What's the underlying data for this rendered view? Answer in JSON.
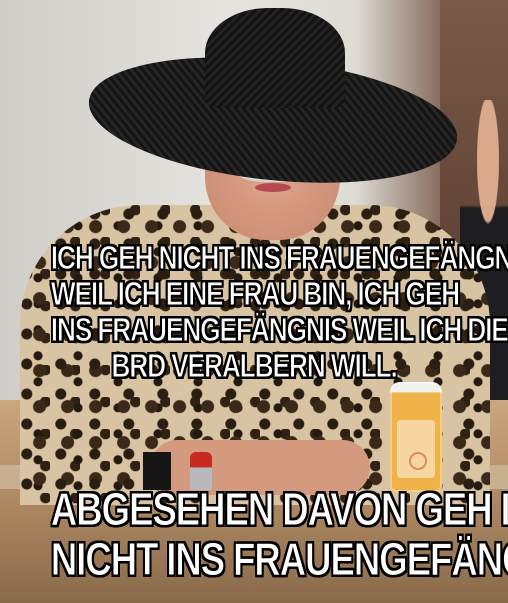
{
  "meme": {
    "top_caption": [
      "ICH GEH NICHT INS FRAUENGEFÄNGNIS",
      "WEIL ICH EINE FRAU BIN, ICH GEH",
      "INS FRAUENGEFÄNGNIS WEIL ICH DIE",
      "BRD VERALBERN WILL."
    ],
    "bottom_caption": [
      "ABGESEHEN DAVON GEH ICH",
      "NICHT INS FRAUENGEFÄNGNIS"
    ]
  },
  "colors": {
    "caption_text": "#ffffff",
    "caption_outline": "#000000",
    "juice": "#f0b34a",
    "lipstick": "#c8281f"
  },
  "icons": {
    "bottle_face": "smiley-face-icon"
  }
}
